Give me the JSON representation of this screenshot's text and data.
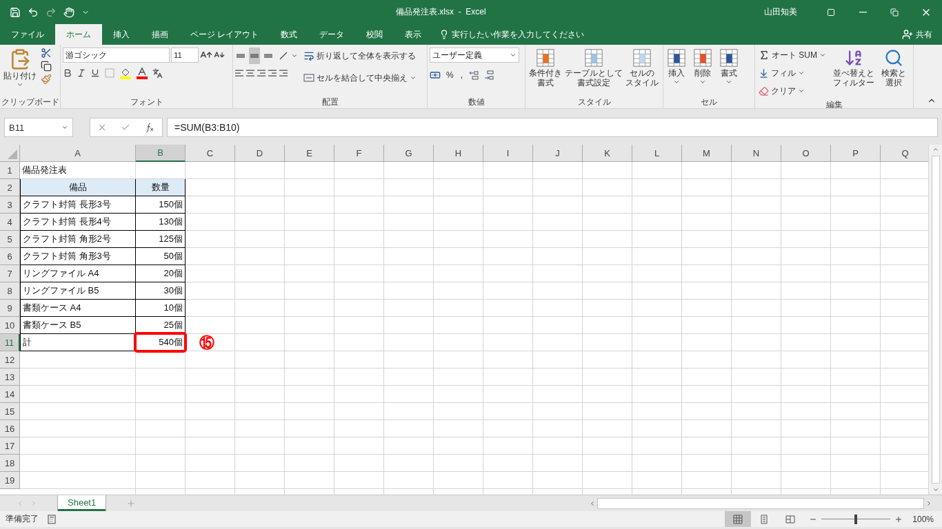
{
  "window": {
    "title": "備品発注表.xlsx  -  Excel",
    "user": "山田知美"
  },
  "tabs": [
    {
      "label": "ファイル",
      "selected": false
    },
    {
      "label": "ホーム",
      "selected": true
    },
    {
      "label": "挿入",
      "selected": false
    },
    {
      "label": "描画",
      "selected": false
    },
    {
      "label": "ページ レイアウト",
      "selected": false
    },
    {
      "label": "数式",
      "selected": false
    },
    {
      "label": "データ",
      "selected": false
    },
    {
      "label": "校閲",
      "selected": false
    },
    {
      "label": "表示",
      "selected": false
    }
  ],
  "tell_me": {
    "placeholder": "実行したい作業を入力してください"
  },
  "share": "共有",
  "clipboard": {
    "label": "クリップボード",
    "paste": "貼り付け"
  },
  "font": {
    "label": "フォント",
    "name": "游ゴシック",
    "size": "11"
  },
  "alignment": {
    "label": "配置",
    "wrap": "折り返して全体を表示する",
    "merge": "セルを結合して中央揃え",
    "vertical": [
      {
        "selected": false
      },
      {
        "selected": true
      },
      {
        "selected": false
      }
    ]
  },
  "number": {
    "label": "数値",
    "format": "ユーザー定義",
    "percent": "%",
    "comma": ","
  },
  "styles": {
    "label": "スタイル",
    "buttons": [
      {
        "lines": [
          "条件付き",
          "書式"
        ]
      },
      {
        "lines": [
          "テーブルとして",
          "書式設定"
        ]
      },
      {
        "lines": [
          "セルの",
          "スタイル"
        ]
      }
    ]
  },
  "cells": {
    "label": "セル",
    "buttons": [
      {
        "kind": "insert",
        "label": "挿入"
      },
      {
        "kind": "delete",
        "label": "削除"
      },
      {
        "kind": "format",
        "label": "書式"
      }
    ]
  },
  "editing": {
    "label": "編集",
    "autosum": "オート SUM",
    "fill": "フィル",
    "clear": "クリア",
    "sort": [
      "並べ替えと",
      "フィルター"
    ],
    "find": [
      "検索と",
      "選択"
    ]
  },
  "formula_bar": {
    "name_box": "B11",
    "formula": "=SUM(B3:B10)"
  },
  "columns": [
    {
      "label": "A",
      "selected": false
    },
    {
      "label": "B",
      "selected": true
    },
    {
      "label": "C",
      "selected": false
    },
    {
      "label": "D",
      "selected": false
    },
    {
      "label": "E",
      "selected": false
    },
    {
      "label": "F",
      "selected": false
    },
    {
      "label": "G",
      "selected": false
    },
    {
      "label": "H",
      "selected": false
    },
    {
      "label": "I",
      "selected": false
    },
    {
      "label": "J",
      "selected": false
    },
    {
      "label": "K",
      "selected": false
    },
    {
      "label": "L",
      "selected": false
    },
    {
      "label": "M",
      "selected": false
    },
    {
      "label": "N",
      "selected": false
    },
    {
      "label": "O",
      "selected": false
    },
    {
      "label": "P",
      "selected": false
    },
    {
      "label": "Q",
      "selected": false
    }
  ],
  "rows": [
    {
      "label": "1",
      "kind": "title",
      "a": "備品発注表",
      "selected": false
    },
    {
      "label": "2",
      "kind": "header",
      "a": "備品",
      "b": "数量",
      "selected": false
    },
    {
      "label": "3",
      "kind": "item",
      "a": "クラフト封筒 長形3号",
      "b": "150個",
      "selected": false
    },
    {
      "label": "4",
      "kind": "item",
      "a": "クラフト封筒 長形4号",
      "b": "130個",
      "selected": false
    },
    {
      "label": "5",
      "kind": "item",
      "a": "クラフト封筒 角形2号",
      "b": "125個",
      "selected": false
    },
    {
      "label": "6",
      "kind": "item",
      "a": "クラフト封筒 角形3号",
      "b": "50個",
      "selected": false
    },
    {
      "label": "7",
      "kind": "item",
      "a": "リングファイル A4",
      "b": "20個",
      "selected": false
    },
    {
      "label": "8",
      "kind": "item",
      "a": "リングファイル B5",
      "b": "30個",
      "selected": false
    },
    {
      "label": "9",
      "kind": "item",
      "a": "書類ケース A4",
      "b": "10個",
      "selected": false
    },
    {
      "label": "10",
      "kind": "item",
      "a": "書類ケース B5",
      "b": "25個",
      "selected": false
    },
    {
      "label": "11",
      "kind": "item",
      "a": "計",
      "b": "540個",
      "selected": true,
      "highlighted": true,
      "callout": "⑮"
    },
    {
      "label": "12",
      "kind": "empty",
      "selected": false
    },
    {
      "label": "13",
      "kind": "empty",
      "selected": false
    },
    {
      "label": "14",
      "kind": "empty",
      "selected": false
    },
    {
      "label": "15",
      "kind": "empty",
      "selected": false
    },
    {
      "label": "16",
      "kind": "empty",
      "selected": false
    },
    {
      "label": "17",
      "kind": "empty",
      "selected": false
    },
    {
      "label": "18",
      "kind": "empty",
      "selected": false
    },
    {
      "label": "19",
      "kind": "empty",
      "selected": false
    }
  ],
  "sheet_tabs": [
    {
      "label": "Sheet1",
      "selected": true
    }
  ],
  "status": {
    "text": "準備完了",
    "views": [
      {
        "selected": true
      },
      {
        "selected": false
      },
      {
        "selected": false
      }
    ],
    "zoom": {
      "level": 0.5,
      "label": "100%"
    }
  }
}
